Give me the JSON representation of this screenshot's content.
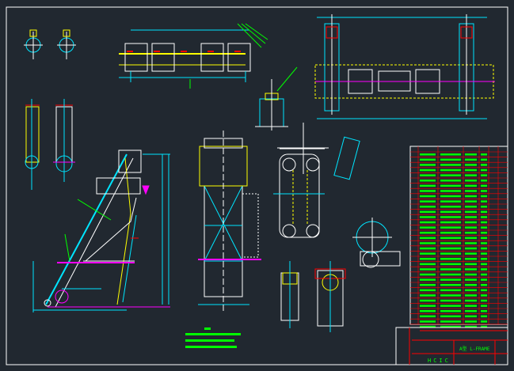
{
  "drawing": {
    "title_block": {
      "company": "HCIC",
      "title": "A型 L-FRAME"
    },
    "colors": {
      "background": "#212830",
      "frame": "#ffffff",
      "cyan": "#00e5ff",
      "yellow": "#ffff00",
      "green": "#00ff00",
      "red": "#ff0000",
      "magenta": "#ff00ff"
    }
  }
}
